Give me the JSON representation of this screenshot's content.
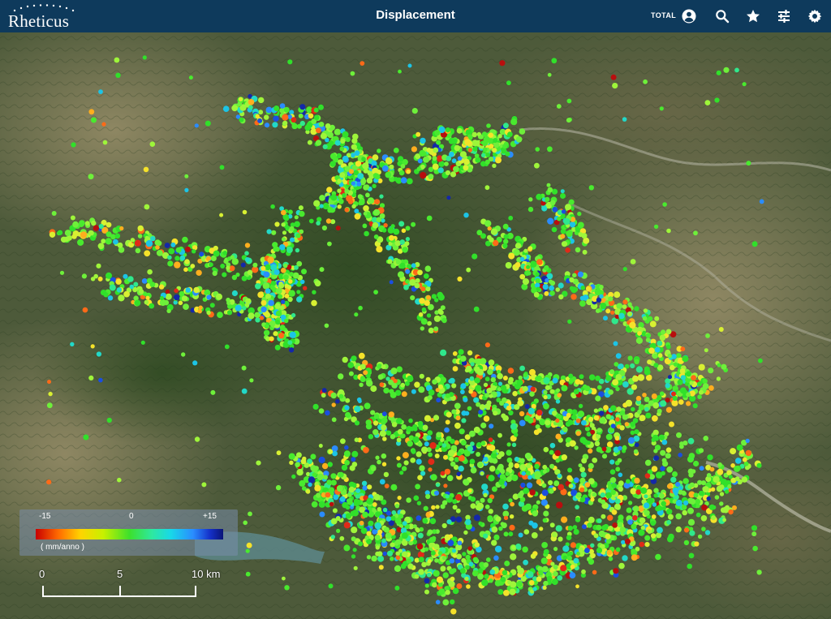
{
  "app": {
    "logo_text": "Rheticus",
    "title": "Displacement",
    "total_label": "TOTAL",
    "icons": [
      "account-icon",
      "search-icon",
      "star-icon",
      "filter-sliders-icon",
      "settings-gear-icon"
    ]
  },
  "legend": {
    "min_label": "-15",
    "mid_label": "0",
    "max_label": "+15",
    "unit": "( mm/anno )",
    "colors": [
      "#c80000",
      "#ff6a00",
      "#ffd400",
      "#c8f000",
      "#3de02c",
      "#2ee8a0",
      "#18d8e8",
      "#2a8cff",
      "#1430c8",
      "#0a1478"
    ]
  },
  "scale_bar": {
    "labels": [
      "0",
      "5",
      "10 km"
    ]
  },
  "map": {
    "basemap": "satellite",
    "point_colors": [
      "#31e02a",
      "#49ea2e",
      "#6ef03a",
      "#9ef53a",
      "#d8f032",
      "#f5e22a",
      "#ffae1e",
      "#ff6a18",
      "#e02a18",
      "#b80e0e",
      "#2fe88c",
      "#22d8c8",
      "#1cc4e6",
      "#2a8cff",
      "#1a4ee0",
      "#1428a8"
    ]
  }
}
